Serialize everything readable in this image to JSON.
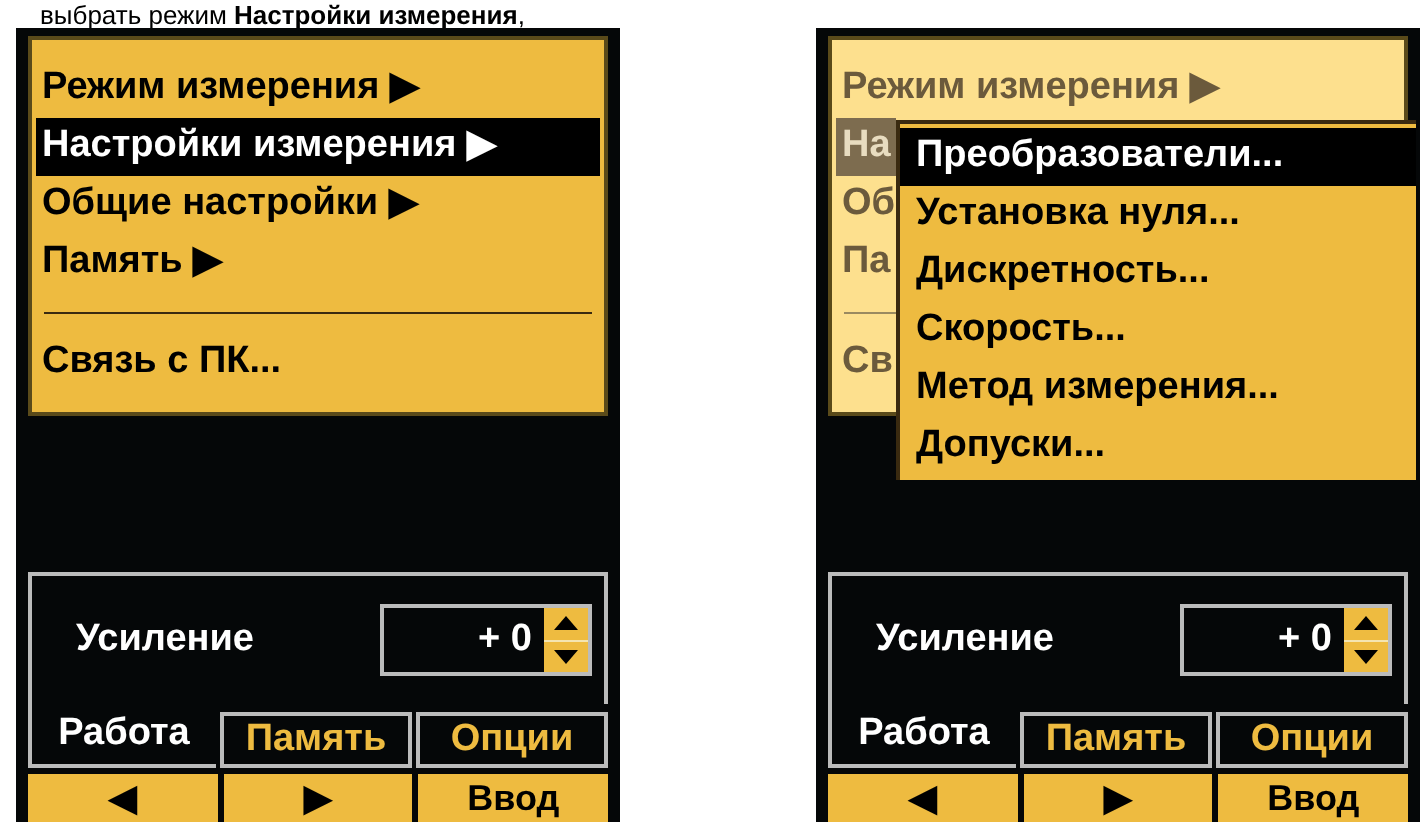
{
  "heading": "выбрать режим **Настройки измерения**,",
  "screens": [
    {
      "dimmed": false,
      "menu": [
        {
          "kind": "item",
          "label": "Режим измерения",
          "arrow": "▶",
          "selected": false
        },
        {
          "kind": "item",
          "label": "Настройки измерения",
          "arrow": "▶",
          "selected": true
        },
        {
          "kind": "item",
          "label": "Общие настройки",
          "arrow": "▶",
          "selected": false
        },
        {
          "kind": "item",
          "label": "Память",
          "arrow": "▶",
          "selected": false
        },
        {
          "kind": "separator"
        },
        {
          "kind": "item",
          "label": "Связь с ПК...",
          "selected": false
        }
      ],
      "gain": {
        "label": "Усиление",
        "value": "+ 0"
      },
      "tabs": [
        {
          "label": "Работа",
          "selected": true
        },
        {
          "label": "Память",
          "selected": false
        },
        {
          "label": "Опции",
          "selected": false
        }
      ],
      "softkeys": [
        "◀",
        "▶",
        "Ввод"
      ]
    },
    {
      "dimmed": true,
      "menu": [
        {
          "kind": "item",
          "label": "Режим измерения",
          "arrow": "▶",
          "selected": false
        },
        {
          "kind": "item",
          "label": "На",
          "selected": true
        },
        {
          "kind": "item",
          "label": "Об",
          "selected": false
        },
        {
          "kind": "item",
          "label": "Па",
          "selected": false
        },
        {
          "kind": "separator"
        },
        {
          "kind": "item",
          "label": "Св",
          "selected": false
        }
      ],
      "submenu": [
        {
          "label": "Преобразователи...",
          "selected": true
        },
        {
          "label": "Установка нуля...",
          "selected": false
        },
        {
          "label": "Дискретность...",
          "selected": false
        },
        {
          "label": "Скорость...",
          "selected": false
        },
        {
          "label": "Метод измерения...",
          "selected": false
        },
        {
          "label": "Допуски...",
          "selected": false
        }
      ],
      "gain": {
        "label": "Усиление",
        "value": "+ 0"
      },
      "tabs": [
        {
          "label": "Работа",
          "selected": true
        },
        {
          "label": "Память",
          "selected": false
        },
        {
          "label": "Опции",
          "selected": false
        }
      ],
      "softkeys": [
        "◀",
        "▶",
        "Ввод"
      ]
    }
  ]
}
